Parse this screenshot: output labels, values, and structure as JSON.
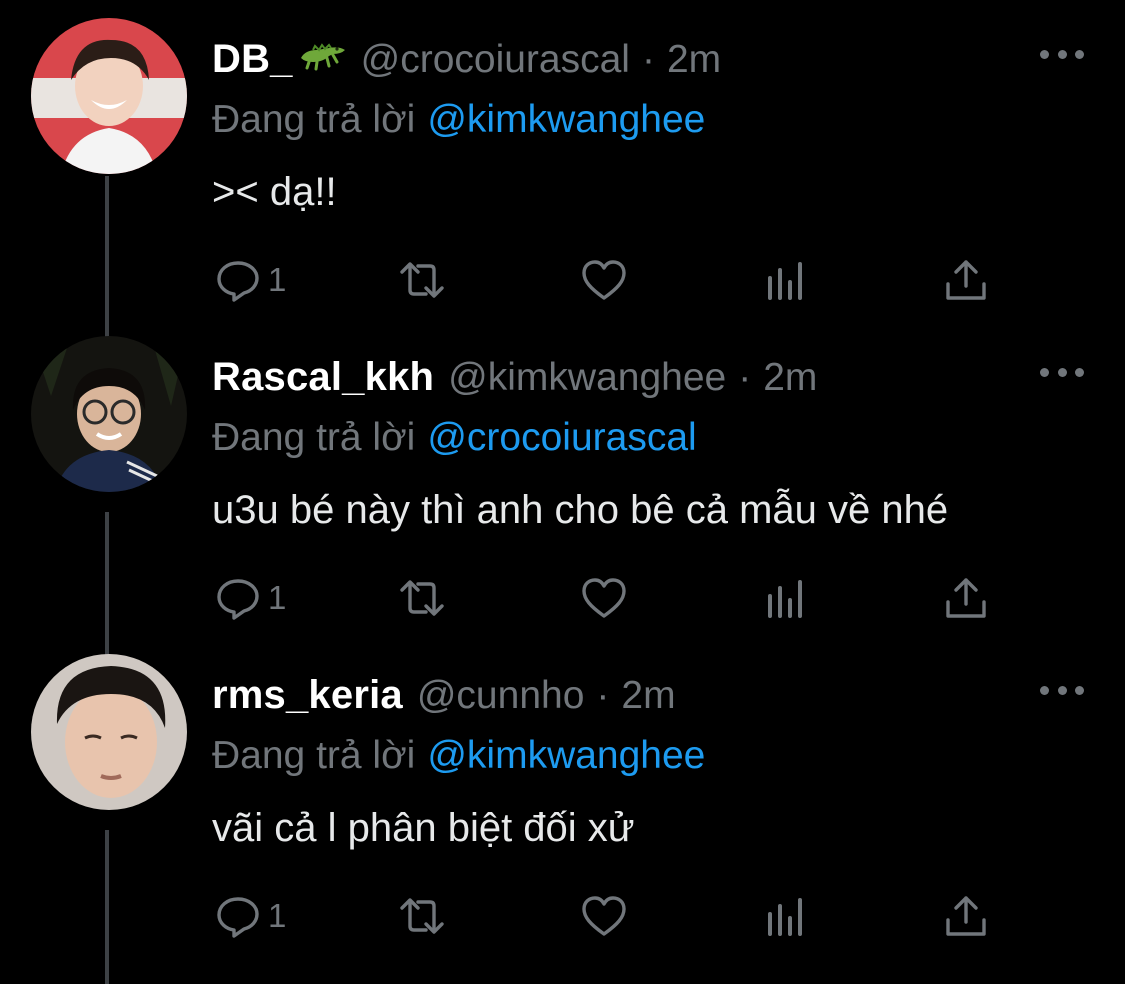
{
  "colors": {
    "background": "#000000",
    "muted": "#71767b",
    "link": "#1d9bf0",
    "thread_line": "#3d4145"
  },
  "tweets": [
    {
      "name": "DB_",
      "name_emoji": "crocodile-emoji",
      "handle": "@crocoiurascal",
      "separator": "·",
      "time": "2m",
      "reply_prefix": "Đang trả lời",
      "reply_to": "@kimkwanghee",
      "text": "><  dạ!!",
      "reply_count": "1"
    },
    {
      "name": "Rascal_kkh",
      "handle": "@kimkwanghee",
      "separator": "·",
      "time": "2m",
      "reply_prefix": "Đang trả lời",
      "reply_to": "@crocoiurascal",
      "text": "u3u bé này thì anh cho bê cả mẫu về nhé",
      "reply_count": "1"
    },
    {
      "name": "rms_keria",
      "handle": "@cunnho",
      "separator": "·",
      "time": "2m",
      "reply_prefix": "Đang trả lời",
      "reply_to": "@kimkwanghee",
      "text": "vãi cả l phân biệt đối xử",
      "reply_count": "1"
    }
  ]
}
